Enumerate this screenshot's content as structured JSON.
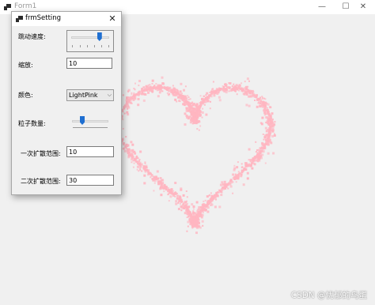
{
  "main_window": {
    "title": "Form1",
    "controls": {
      "minimize": "—",
      "maximize": "☐",
      "close": "✕"
    },
    "heart_color": "#ffb6c1"
  },
  "watermark": "CSDN @忧郁的鸟蛋",
  "dialog": {
    "title": "frmSetting",
    "close_label": "✕",
    "fields": {
      "speed_label": "跳动速度:",
      "speed_value": 0.78,
      "scale_label": "缩放:",
      "scale_value": "10",
      "color_label": "颜色:",
      "color_value": "LightPink",
      "particles_label": "粒子数量:",
      "particles_value": 0.25,
      "spread1_label": "一次扩散范围:",
      "spread1_value": "10",
      "spread2_label": "二次扩散范围:",
      "spread2_value": "30"
    }
  }
}
